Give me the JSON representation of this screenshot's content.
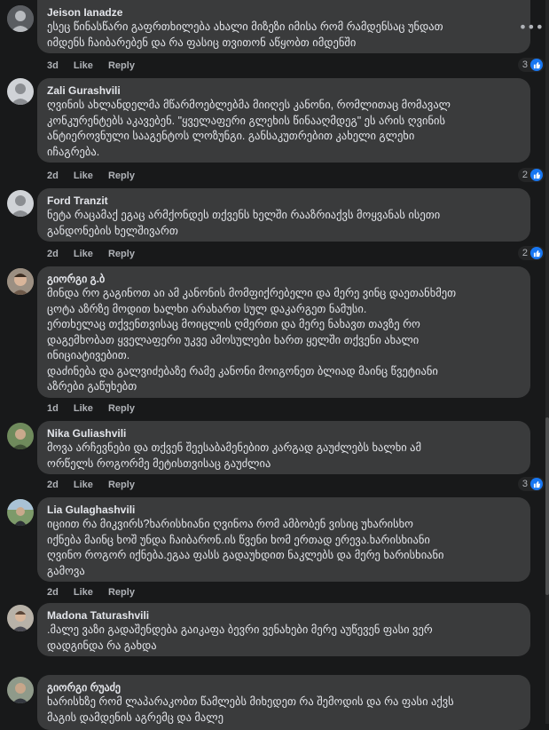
{
  "comments": [
    {
      "author": "Jeison Ianadze",
      "lines": [
        "ესეც წინასწარი გაფრთხილება ახალი მიზეზი იმისა რომ რამდენსაც უნდათ",
        "იმდენს ჩაიბარებენ და რა ფასიც თვითონ აწყობთ იმდენში"
      ],
      "time": "3d",
      "like": "Like",
      "reply": "Reply",
      "reactions": "3"
    },
    {
      "author": "Zali Gurashvili",
      "lines": [
        "ღვინის ახლანდელმა მწარმოებლებმა მიიღეს კანონი, რომლითაც მომავალ",
        "კონკურენტებს აკავებენ. \"ყველაფერი გლეხის წინააღმდეგ\" ეს არის ღვინის",
        "ანტიეროვნული სააგენტოს ლოზუნგი. განსაკუთრებით კახელი გლეხი",
        "იჩაგრება."
      ],
      "time": "2d",
      "like": "Like",
      "reply": "Reply",
      "reactions": "2"
    },
    {
      "author": "Ford Tranzit",
      "lines": [
        "ნეტა რაცამაქ ეგაც არმქონდეს თქვენს ხელში რააზრიაქვს მოყვანას ისეთი",
        "განდონების ხელშივართ"
      ],
      "time": "2d",
      "like": "Like",
      "reply": "Reply",
      "reactions": "2"
    },
    {
      "author": "გიორგი გ.ბ",
      "lines": [
        "მინდა რო გაგინოთ აი ამ კანონის მომფიქრებელი და მერე ვინც დაეთანხმეთ",
        "ცოტა აზრზე მოდით ხალხი არახართ სულ დაკარგეთ ნამუსი.",
        "ერთხელაც თქვენთვისაც მოიცლის ღმერთი და მერე ნახავთ თავზე რო",
        "დაგემხობათ ყველაფერი უკვე ამოსულები ხართ ყელში თქვენი ახალი",
        "ინიციატივებით.",
        "დაძინება და გალვიძებაზე რამე კანონი მოიგონეთ ბლიად მაინც წვეტიანი",
        "აზრები გაწუხებთ"
      ],
      "time": "1d",
      "like": "Like",
      "reply": "Reply",
      "reactions": ""
    },
    {
      "author": "Nika Guliashvili",
      "lines": [
        "მოვა არჩევნები და თქვენ შეესაბამენებით კარგად გაუძლებს ხალხი ამ",
        "ორწელს როგორმე მეტისთვისაც გაუძლია"
      ],
      "time": "2d",
      "like": "Like",
      "reply": "Reply",
      "reactions": "3"
    },
    {
      "author": "Lia Gulaghashvili",
      "lines": [
        "იციით რა მიკვირს?ხარისხიანი ღვინოა რომ ამბობენ ვისიც უხარისხო",
        "იქნება მაინც ხოშ უნდა ჩაიბარონ.ის წვენი ხომ ერთად ერევა.ხარისხიანი",
        "ღვინო როგორ იქნება.ეგაა ფასს გადაუხდით ნაკლებს და მერე ხარისხიანი",
        "გამოვა"
      ],
      "time": "2d",
      "like": "Like",
      "reply": "Reply",
      "reactions": ""
    },
    {
      "author": "Madona Taturashvili",
      "lines": [
        ".მალე ვაზი გადაშენდება გაიკაფა ბევრი ვენახები მერე აუწევენ ფასი ვერ",
        "დადგინდა რა გახდა"
      ],
      "time": "2d",
      "like": "Like",
      "reply": "Reply",
      "reactions": ""
    },
    {
      "author": "გიორგი რუაძე",
      "lines": [
        "ხარისხზე რომ ლაპარაკობთ წამლებს მიხედეთ რა შემოდის და რა ფასი აქვს",
        "მაგის დამდენის აგრემც და მალე"
      ],
      "time": "",
      "like": "",
      "reply": "",
      "reactions": ""
    }
  ],
  "colors": {
    "background": "#18191a",
    "bubble": "#3a3b3c",
    "text": "#e4e6eb",
    "meta": "#b0b3b8",
    "like_badge": "#1877f2"
  },
  "icons": {
    "more": "ellipsis-icon",
    "reaction": "thumbs-up-icon"
  }
}
